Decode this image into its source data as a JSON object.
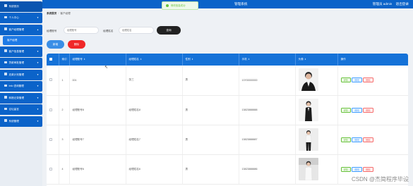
{
  "header": {
    "title": "管理系统",
    "user": "管理员 admin",
    "logout": "退出登录"
  },
  "toast": {
    "text": "修改信息成功"
  },
  "sidebar": {
    "items": [
      {
        "label": "系统首页"
      },
      {
        "label": "个人中心"
      },
      {
        "label": "客户经理管理"
      },
      {
        "label": "客户信息管理"
      },
      {
        "label": "贷款审批管理"
      },
      {
        "label": "还款计划管理"
      },
      {
        "label": "Info 咨询管理"
      },
      {
        "label": "转账记录管理"
      },
      {
        "label": "论坛留言"
      },
      {
        "label": "系统管理"
      }
    ],
    "active_sub": "客户经理"
  },
  "breadcrumb": {
    "home": "系统首页",
    "current": "客户经理"
  },
  "search": {
    "label1": "经理账号",
    "placeholder1": "经理账号",
    "label2": "经理姓名",
    "placeholder2": "经理姓名",
    "button": "查询"
  },
  "actions": {
    "add": "新增",
    "delete": "删除"
  },
  "table": {
    "headers": {
      "index": "索引",
      "account": "经理账号",
      "name": "经理姓名",
      "gender": "性别",
      "phone": "手机",
      "avatar": "头像",
      "ops": "操作"
    },
    "ops": {
      "detail": "详情",
      "edit": "修改",
      "delete": "删除"
    },
    "rows": [
      {
        "index": "1",
        "account": "001",
        "name": "张三",
        "gender": "男",
        "phone": "13700000000"
      },
      {
        "index": "2",
        "account": "经理账号8",
        "name": "经理姓名8",
        "gender": "男",
        "phone": "13823888888"
      },
      {
        "index": "3",
        "account": "经理账号7",
        "name": "经理姓名7",
        "gender": "男",
        "phone": "13823888887"
      },
      {
        "index": "4",
        "account": "经理账号6",
        "name": "经理姓名6",
        "gender": "男",
        "phone": "13823888886"
      }
    ]
  },
  "watermark": "CSDN @杰简程序毕设",
  "colors": {
    "primary": "#0b63c9",
    "header_row": "#1572d8",
    "danger": "#f02828",
    "success": "#67c23a"
  }
}
